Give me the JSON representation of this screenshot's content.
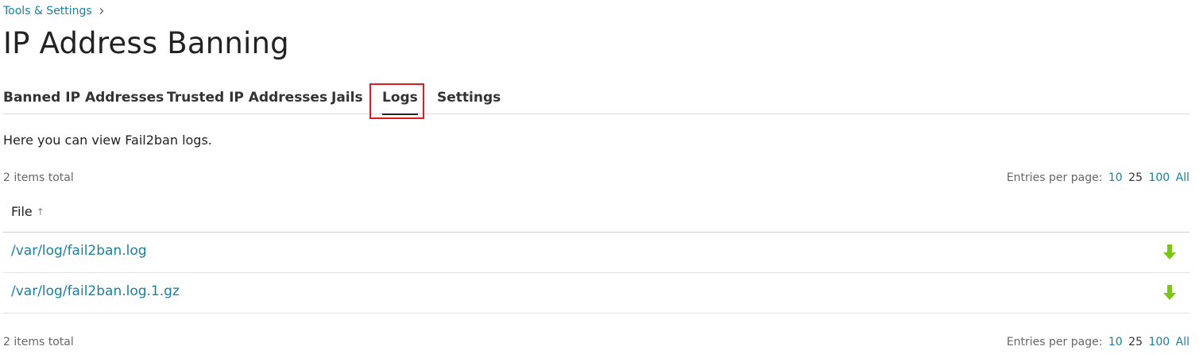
{
  "breadcrumb": {
    "items": [
      "Tools & Settings"
    ]
  },
  "page": {
    "title": "IP Address Banning"
  },
  "tabs": [
    {
      "label": "Banned IP Addresses",
      "active": false
    },
    {
      "label": "Trusted IP Addresses",
      "active": false
    },
    {
      "label": "Jails",
      "active": false
    },
    {
      "label": "Logs",
      "active": true
    },
    {
      "label": "Settings",
      "active": false
    }
  ],
  "intro": "Here you can view Fail2ban logs.",
  "summary": {
    "total": "2 items total",
    "entries_label": "Entries per page:",
    "entries_options": [
      "10",
      "25",
      "100",
      "All"
    ],
    "entries_current": "25"
  },
  "table": {
    "columns": [
      {
        "label": "File",
        "sort": "ascending",
        "sort_icon": "arrow-up-icon"
      }
    ],
    "rows": [
      {
        "file": "/var/log/fail2ban.log",
        "action_icon": "download-icon"
      },
      {
        "file": "/var/log/fail2ban.log.1.gz",
        "action_icon": "download-icon"
      }
    ]
  },
  "colors": {
    "link": "#1a7fa0",
    "download_icon": "#7cc619",
    "tab_highlight": "#e01b1b"
  }
}
